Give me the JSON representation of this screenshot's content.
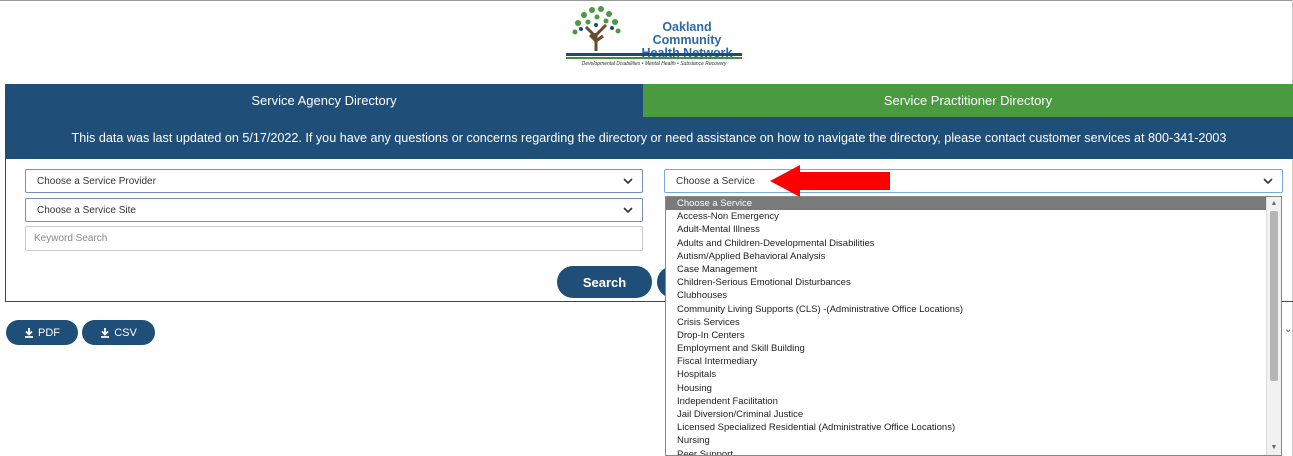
{
  "logo": {
    "name_line1": "Oakland Community",
    "name_line2": "Health Network",
    "tagline": "Developmental Disabilities • Mental Health • Substance Recovery"
  },
  "tabs": {
    "agency": "Service Agency Directory",
    "practitioner": "Service Practitioner Directory"
  },
  "banner": "This data was last updated on 5/17/2022. If you have any questions or concerns regarding the directory or need assistance on how to navigate the directory, please contact customer services at 800-341-2003",
  "filters": {
    "provider": "Choose a Service Provider",
    "site": "Choose a Service Site",
    "service": "Choose a Service",
    "keyword_placeholder": "Keyword Search"
  },
  "buttons": {
    "search": "Search",
    "pdf": "PDF",
    "csv": "CSV"
  },
  "service_options": [
    "Choose a Service",
    "Access-Non Emergency",
    "Adult-Mental Illness",
    "Adults and Children-Developmental Disabilities",
    "Autism/Applied Behavioral Analysis",
    "Case Management",
    "Children-Serious Emotional Disturbances",
    "Clubhouses",
    "Community Living Supports (CLS) -(Administrative Office Locations)",
    "Crisis Services",
    "Drop-In Centers",
    "Employment and Skill Building",
    "Fiscal Intermediary",
    "Hospitals",
    "Housing",
    "Independent Facilitation",
    "Jail Diversion/Criminal Justice",
    "Licensed Specialized Residential (Administrative Office Locations)",
    "Nursing",
    "Peer Support"
  ],
  "colors": {
    "navy": "#1f4e79",
    "green": "#4a9a3f",
    "arrow": "#ff0000"
  }
}
